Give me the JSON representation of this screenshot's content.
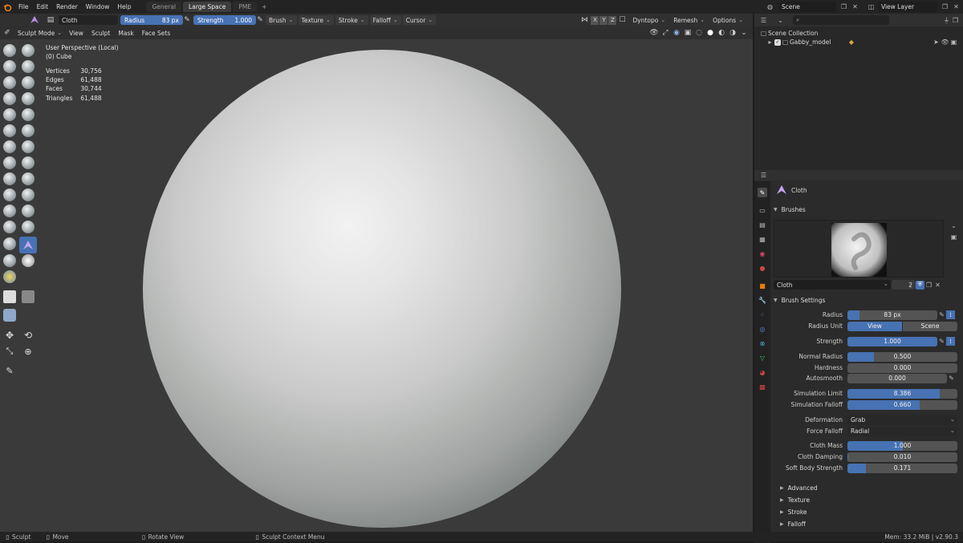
{
  "menu": [
    "File",
    "Edit",
    "Render",
    "Window",
    "Help"
  ],
  "workspaces": [
    {
      "label": "General",
      "active": false
    },
    {
      "label": "Large Space",
      "active": true
    },
    {
      "label": "PME",
      "active": false
    }
  ],
  "plus": "+",
  "scene": {
    "value": "Scene"
  },
  "view_layer": {
    "value": "View Layer"
  },
  "tool_header": {
    "brush_name": "Cloth",
    "radius_label": "Radius",
    "radius_value": "83 px",
    "strength_label": "Strength",
    "strength_value": "1.000",
    "dropdowns": [
      "Brush",
      "Texture",
      "Stroke",
      "Falloff",
      "Cursor"
    ],
    "axes": [
      "X",
      "Y",
      "Z"
    ],
    "right_dropdowns": [
      "Dyntopo",
      "Remesh",
      "Options"
    ]
  },
  "mode_header": {
    "mode": "Sculpt Mode",
    "menus": [
      "View",
      "Sculpt",
      "Mask",
      "Face Sets"
    ]
  },
  "viewport": {
    "perspective": "User Perspective (Local)",
    "object": "(0) Cube",
    "stats": [
      {
        "label": "Vertices",
        "value": "30,756"
      },
      {
        "label": "Edges",
        "value": "61,488"
      },
      {
        "label": "Faces",
        "value": "30,744"
      },
      {
        "label": "Triangles",
        "value": "61,488"
      }
    ]
  },
  "outliner": {
    "root": "Scene Collection",
    "items": [
      {
        "label": "Gabby_model"
      }
    ]
  },
  "properties": {
    "active_tool": "Cloth",
    "brushes_panel": "Brushes",
    "brush_field": "Cloth",
    "brush_users": "2",
    "settings_panel": "Brush Settings",
    "rows": [
      {
        "label": "Radius",
        "value": "83 px",
        "fill": 0.13
      },
      {
        "label": "Strength",
        "value": "1.000",
        "fill": 1.0
      },
      {
        "label": "Normal Radius",
        "value": "0.500",
        "fill": 0.24
      },
      {
        "label": "Hardness",
        "value": "0.000",
        "fill": 0
      },
      {
        "label": "Autosmooth",
        "value": "0.000",
        "fill": 0
      },
      {
        "label": "Simulation Limit",
        "value": "8.386",
        "fill": 0.84
      },
      {
        "label": "Simulation Falloff",
        "value": "0.660",
        "fill": 0.66
      },
      {
        "label": "Cloth Mass",
        "value": "1.000",
        "fill": 0.5
      },
      {
        "label": "Cloth Damping",
        "value": "0.010",
        "fill": 0.01
      },
      {
        "label": "Soft Body Strength",
        "value": "0.171",
        "fill": 0.17
      }
    ],
    "radius_unit_label": "Radius Unit",
    "radius_unit_options": [
      "View",
      "Scene"
    ],
    "deformation_label": "Deformation",
    "deformation_value": "Grab",
    "force_falloff_label": "Force Falloff",
    "force_falloff_value": "Radial",
    "collapsed": [
      "Advanced",
      "Texture",
      "Stroke",
      "Falloff"
    ]
  },
  "statusbar": {
    "items": [
      "Sculpt",
      "Move",
      "Rotate View",
      "Sculpt Context Menu"
    ],
    "mem": "Mem: 33.2 MiB | v2.90.3"
  },
  "colors": {
    "accent": "#4772b3",
    "blender_orange": "#e87d0d",
    "panel": "#2b2b2b",
    "viewport": "#3a3a3a"
  }
}
